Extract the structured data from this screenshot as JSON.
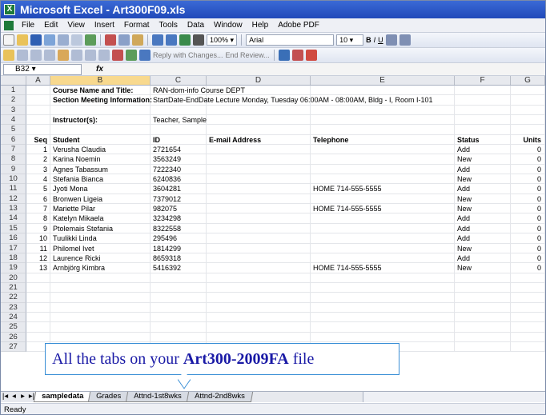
{
  "window": {
    "title": "Microsoft Excel - Art300F09.xls"
  },
  "menu": [
    "File",
    "Edit",
    "View",
    "Insert",
    "Format",
    "Tools",
    "Data",
    "Window",
    "Help",
    "Adobe PDF"
  ],
  "toolbar": {
    "zoom": "100%",
    "font": "Arial",
    "font_size": "10",
    "bold": "B",
    "italic": "I",
    "underline": "U",
    "reply_text": "Reply with Changes...",
    "end_review": "End Review..."
  },
  "formula": {
    "cell_ref": "B32",
    "fx": "fx",
    "value": ""
  },
  "columns": [
    "A",
    "B",
    "C",
    "D",
    "E",
    "F",
    "G"
  ],
  "selected_column": "B",
  "rows": [
    {
      "n": "1",
      "A": "",
      "B": "Course Name and Title:",
      "C": "RAN-dom-info Course DEPT",
      "D": "",
      "E": "",
      "F": "",
      "G": "",
      "bold": true
    },
    {
      "n": "2",
      "A": "",
      "B": "Section Meeting Information:",
      "C": "StartDate-EndDate Lecture Monday, Tuesday 06:00AM - 08:00AM, Bldg - I, Room I-101",
      "D": "",
      "E": "",
      "F": "",
      "G": "",
      "bold": true
    },
    {
      "n": "3",
      "A": "",
      "B": "",
      "C": "",
      "D": "",
      "E": "",
      "F": "",
      "G": ""
    },
    {
      "n": "4",
      "A": "",
      "B": "Instructor(s):",
      "C": "Teacher, Sample",
      "D": "",
      "E": "",
      "F": "",
      "G": "",
      "bold": true
    },
    {
      "n": "5",
      "A": "",
      "B": "",
      "C": "",
      "D": "",
      "E": "",
      "F": "",
      "G": ""
    },
    {
      "n": "6",
      "A": "Seq",
      "B": "Student",
      "C": "ID",
      "D": "E-mail Address",
      "E": "Telephone",
      "F": "Status",
      "G": "Units",
      "header": true
    },
    {
      "n": "7",
      "A": "1",
      "B": "Verusha Claudia",
      "C": "2721654",
      "D": "",
      "E": "",
      "F": "Add",
      "G": "0"
    },
    {
      "n": "8",
      "A": "2",
      "B": "Karina Noemin",
      "C": "3563249",
      "D": "",
      "E": "",
      "F": "New",
      "G": "0"
    },
    {
      "n": "9",
      "A": "3",
      "B": "Agnes Tabassum",
      "C": "7222340",
      "D": "",
      "E": "",
      "F": "Add",
      "G": "0"
    },
    {
      "n": "10",
      "A": "4",
      "B": "Stefania Bianca",
      "C": "6240836",
      "D": "",
      "E": "",
      "F": "New",
      "G": "0"
    },
    {
      "n": "11",
      "A": "5",
      "B": "Jyoti Mona",
      "C": "3604281",
      "D": "",
      "E": "HOME 714-555-5555",
      "F": "Add",
      "G": "0"
    },
    {
      "n": "12",
      "A": "6",
      "B": "Bronwen Ligeia",
      "C": "7379012",
      "D": "",
      "E": "",
      "F": "New",
      "G": "0"
    },
    {
      "n": "13",
      "A": "7",
      "B": "Mariette Pilar",
      "C": "982075",
      "D": "",
      "E": "HOME 714-555-5555",
      "F": "New",
      "G": "0"
    },
    {
      "n": "14",
      "A": "8",
      "B": "Katelyn Mikaela",
      "C": "3234298",
      "D": "",
      "E": "",
      "F": "Add",
      "G": "0"
    },
    {
      "n": "15",
      "A": "9",
      "B": "Ptolemais Stefania",
      "C": "8322558",
      "D": "",
      "E": "",
      "F": "Add",
      "G": "0"
    },
    {
      "n": "16",
      "A": "10",
      "B": "Tuulikki Linda",
      "C": "295496",
      "D": "",
      "E": "",
      "F": "Add",
      "G": "0"
    },
    {
      "n": "17",
      "A": "11",
      "B": "Philomel Ivet",
      "C": "1814299",
      "D": "",
      "E": "",
      "F": "New",
      "G": "0"
    },
    {
      "n": "18",
      "A": "12",
      "B": "Laurence Ricki",
      "C": "8659318",
      "D": "",
      "E": "",
      "F": "Add",
      "G": "0"
    },
    {
      "n": "19",
      "A": "13",
      "B": "Arnbjörg Kimbra",
      "C": "5416392",
      "D": "",
      "E": "HOME 714-555-5555",
      "F": "New",
      "G": "0"
    },
    {
      "n": "20"
    },
    {
      "n": "21"
    },
    {
      "n": "22"
    },
    {
      "n": "23"
    },
    {
      "n": "24"
    },
    {
      "n": "25"
    },
    {
      "n": "26"
    },
    {
      "n": "27"
    }
  ],
  "callout": {
    "prefix": "All the tabs on your",
    "file": "Art300-2009FA",
    "suffix": "file"
  },
  "sheet_tabs": [
    "sampledata",
    "Grades",
    "Attnd-1st8wks",
    "Attnd-2nd8wks"
  ],
  "active_tab": "sampledata",
  "status": "Ready"
}
